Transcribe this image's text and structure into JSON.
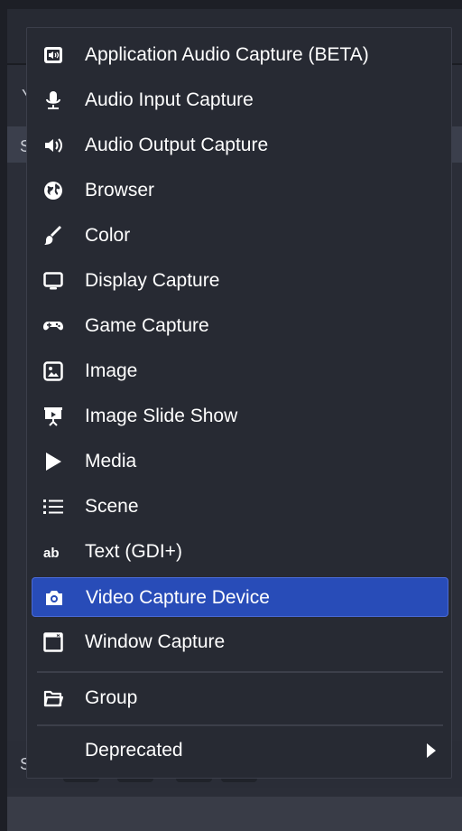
{
  "background": {
    "left_letters": [
      "Y",
      "S",
      "S"
    ]
  },
  "menu": {
    "items": [
      {
        "label": "Application Audio Capture (BETA)",
        "icon": "app-audio-icon"
      },
      {
        "label": "Audio Input Capture",
        "icon": "microphone-icon"
      },
      {
        "label": "Audio Output Capture",
        "icon": "speaker-icon"
      },
      {
        "label": "Browser",
        "icon": "globe-icon"
      },
      {
        "label": "Color",
        "icon": "brush-icon"
      },
      {
        "label": "Display Capture",
        "icon": "monitor-icon"
      },
      {
        "label": "Game Capture",
        "icon": "gamepad-icon"
      },
      {
        "label": "Image",
        "icon": "image-icon"
      },
      {
        "label": "Image Slide Show",
        "icon": "slideshow-icon"
      },
      {
        "label": "Media",
        "icon": "play-icon"
      },
      {
        "label": "Scene",
        "icon": "list-icon"
      },
      {
        "label": "Text (GDI+)",
        "icon": "text-icon"
      },
      {
        "label": "Video Capture Device",
        "icon": "camera-icon",
        "selected": true
      },
      {
        "label": "Window Capture",
        "icon": "window-icon"
      }
    ],
    "group": {
      "label": "Group",
      "icon": "folder-icon"
    },
    "deprecated": {
      "label": "Deprecated",
      "icon": "chevron-right-icon"
    }
  },
  "colors": {
    "highlight": "#284cb8",
    "menu_bg": "#272a33",
    "text": "#ffffff"
  }
}
